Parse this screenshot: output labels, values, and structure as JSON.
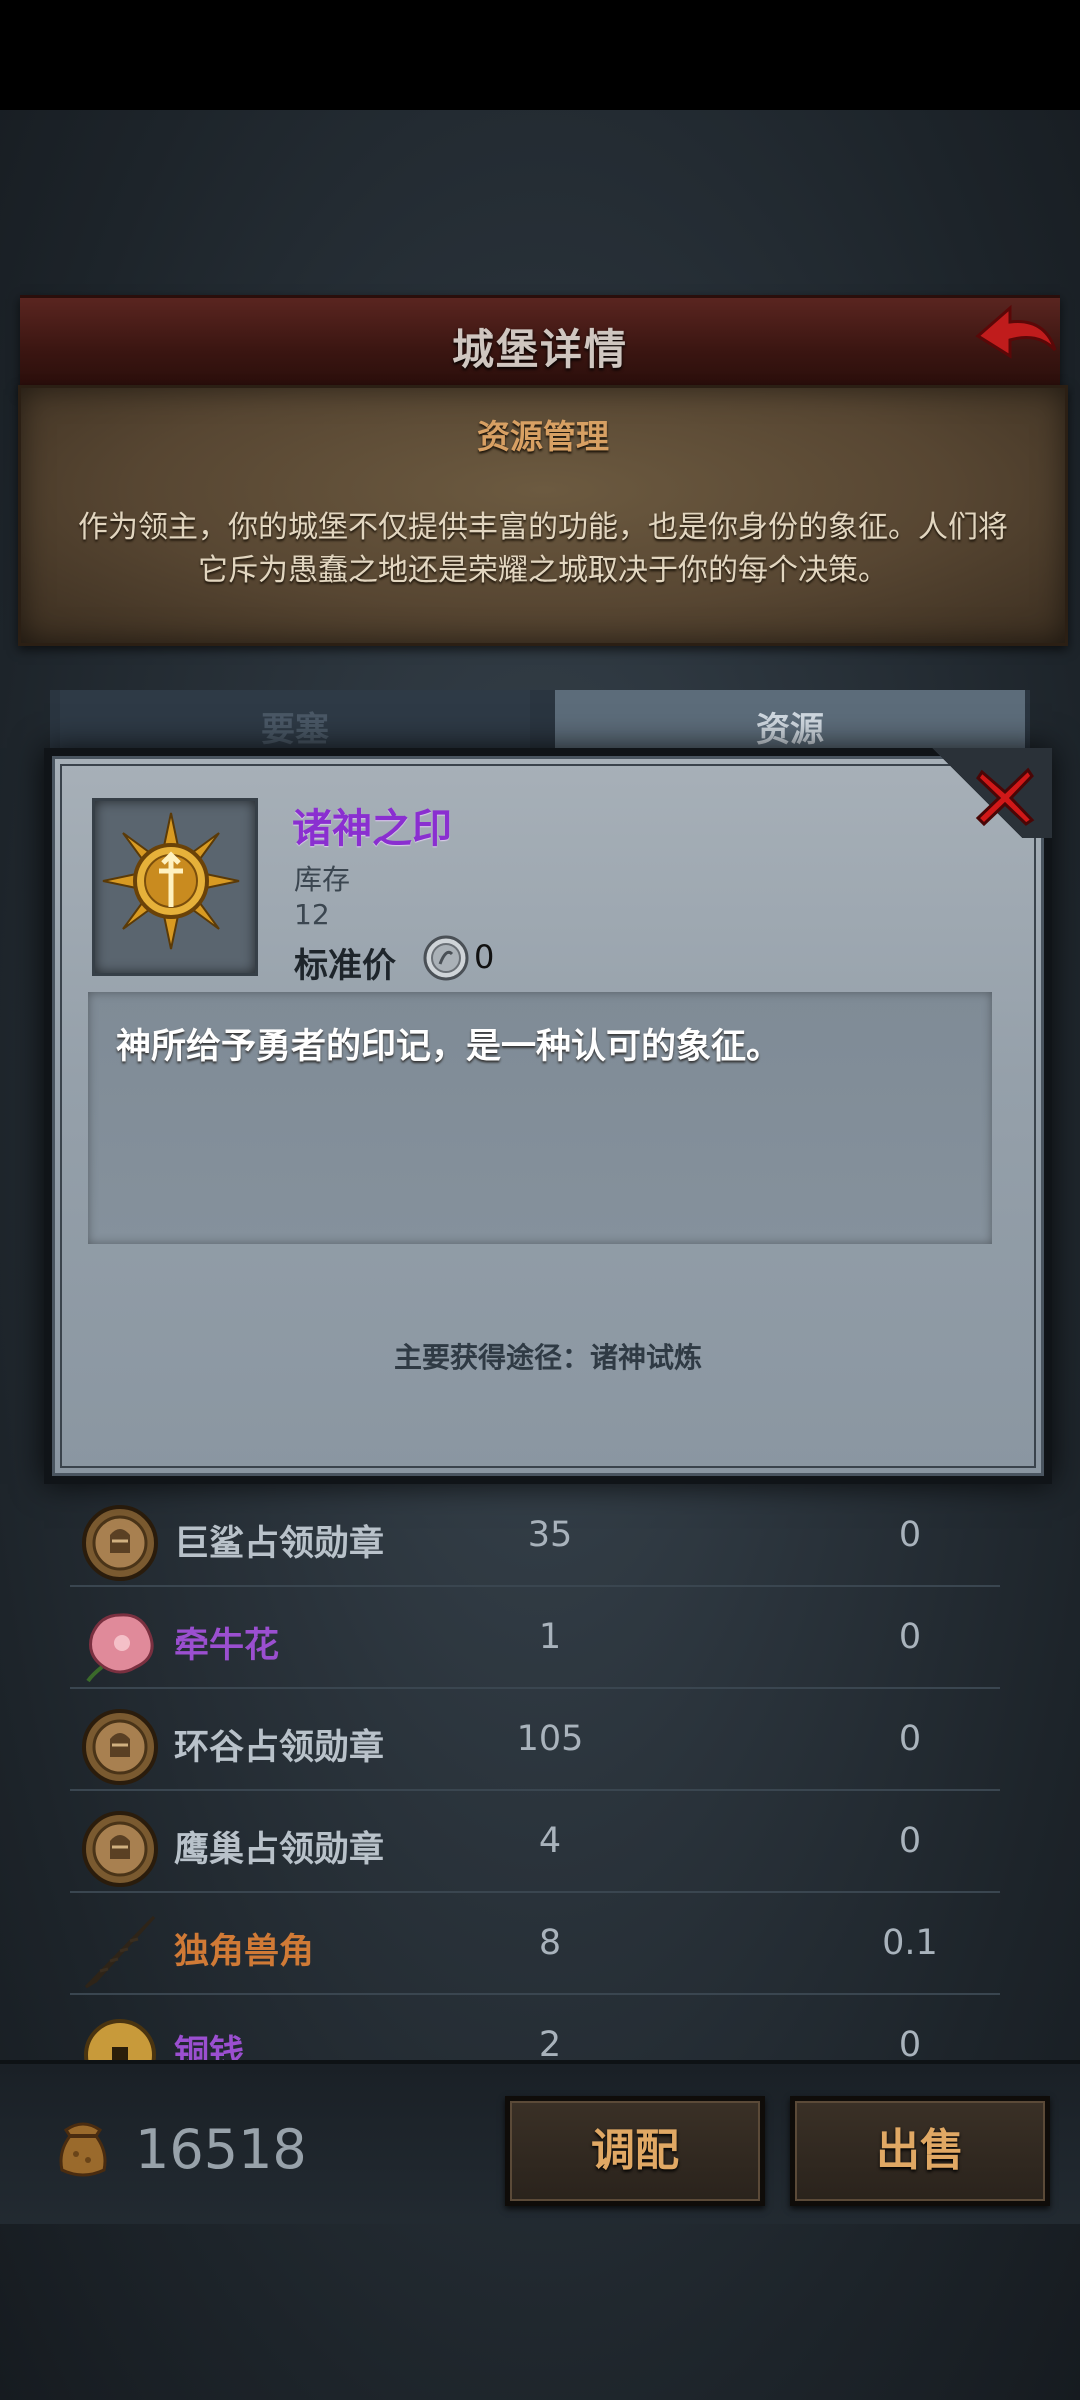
{
  "header": {
    "title": "城堡详情"
  },
  "info": {
    "title": "资源管理",
    "text": "作为领主，你的城堡不仅提供丰富的功能，也是你身份的象征。人们将它斥为愚蠢之地还是荣耀之城取决于你的每个决策。"
  },
  "tabs": [
    {
      "label": "要塞"
    },
    {
      "label": "资源"
    }
  ],
  "popup": {
    "item_name": "诸神之印",
    "stock_label": "库存",
    "stock_value": "12",
    "price_label": "标准价",
    "price_value": "0",
    "description": "神所给予勇者的印记，是一种认可的象征。",
    "source": "主要获得途径：诸神试炼"
  },
  "resources": [
    {
      "name": "巨鲨占领勋章",
      "qty": "35",
      "price": "0",
      "color": "#b9c2ca",
      "icon": "medal-icon"
    },
    {
      "name": "牵牛花",
      "qty": "1",
      "price": "0",
      "color": "#9b4fd0",
      "icon": "flower-icon"
    },
    {
      "name": "环谷占领勋章",
      "qty": "105",
      "price": "0",
      "color": "#b9c2ca",
      "icon": "medal-icon"
    },
    {
      "name": "鹰巢占领勋章",
      "qty": "4",
      "price": "0",
      "color": "#b9c2ca",
      "icon": "medal-icon"
    },
    {
      "name": "独角兽角",
      "qty": "8",
      "price": "0.1",
      "color": "#d07a36",
      "icon": "horn-icon"
    },
    {
      "name": "铜钱",
      "qty": "2",
      "price": "0",
      "color": "#9b4fd0",
      "icon": "coin-icon"
    }
  ],
  "footer": {
    "gold": "16518",
    "allocate_label": "调配",
    "sell_label": "出售"
  }
}
